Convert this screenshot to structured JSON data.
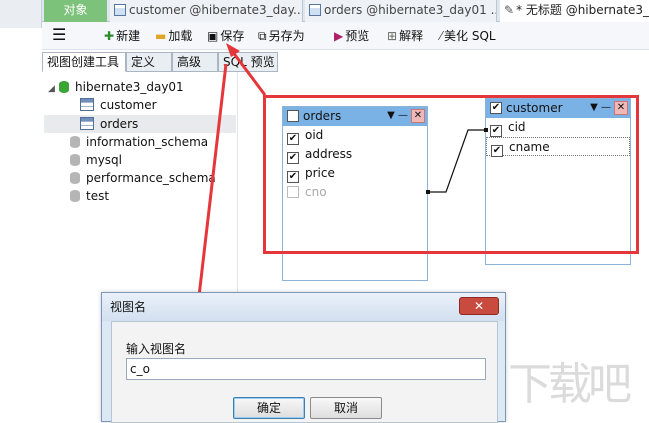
{
  "tabs": {
    "objects": "对象",
    "tab_customer": "customer @hibernate3_day...",
    "tab_orders": "orders @hibernate3_day01 ...",
    "tab_untitled": "* 无标题 @hibernate3_d"
  },
  "toolbar": {
    "new": "新建",
    "load": "加载",
    "save": "保存",
    "save_as": "另存为",
    "preview": "预览",
    "explain": "解释",
    "beautify": "美化 SQL"
  },
  "subtabs": [
    "视图创建工具",
    "定义",
    "高级",
    "SQL 预览"
  ],
  "tree": {
    "db_main": "hibernate3_day01",
    "tables": [
      "customer",
      "orders"
    ],
    "other_dbs": [
      "information_schema",
      "mysql",
      "performance_schema",
      "test"
    ]
  },
  "entities": {
    "orders": {
      "name": "orders",
      "fields": [
        {
          "name": "oid",
          "checked": true
        },
        {
          "name": "address",
          "checked": true
        },
        {
          "name": "price",
          "checked": true
        },
        {
          "name": "cno",
          "checked": false
        }
      ]
    },
    "customer": {
      "name": "customer",
      "fields": [
        {
          "name": "cid",
          "checked": true
        },
        {
          "name": "cname",
          "checked": true
        }
      ]
    }
  },
  "dialog": {
    "title": "视图名",
    "close": "✕",
    "label": "输入视图名",
    "value": "c_o",
    "ok": "确定",
    "cancel": "取消"
  },
  "watermark": "下载吧",
  "colors": {
    "highlight": "#e5373b",
    "entity_header": "#7bb2e6",
    "objects_tab": "#7cc27a"
  }
}
